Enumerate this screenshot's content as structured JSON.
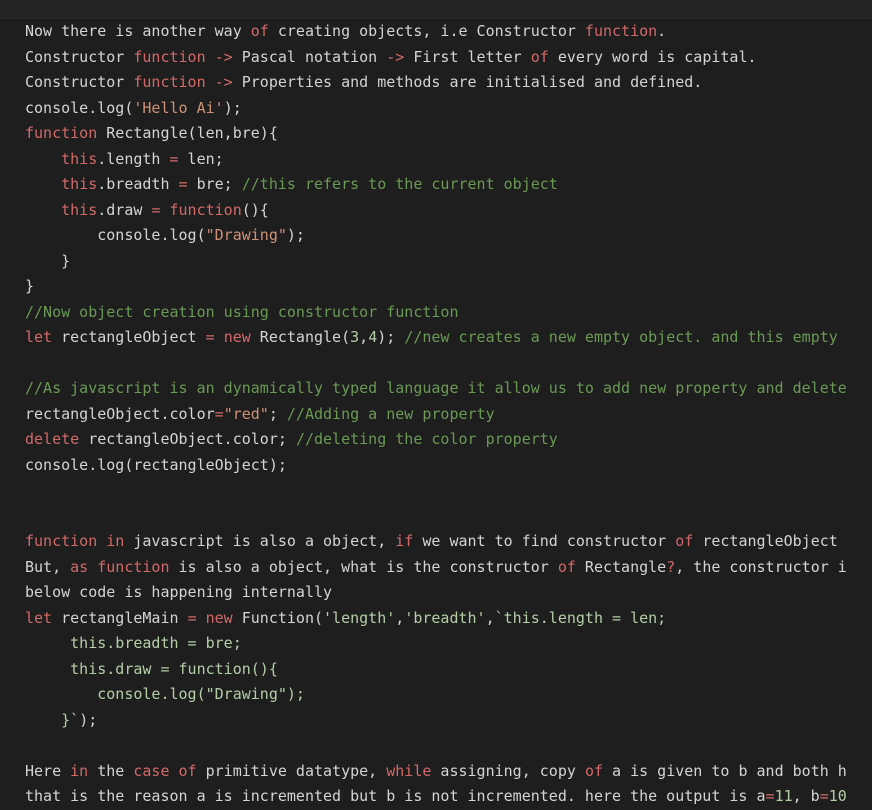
{
  "lines": [
    [
      {
        "c": "plain",
        "t": "Now there is another way "
      },
      {
        "c": "kw2",
        "t": "of"
      },
      {
        "c": "plain",
        "t": " creating objects, i.e Constructor "
      },
      {
        "c": "kw2",
        "t": "function"
      },
      {
        "c": "plain",
        "t": "."
      }
    ],
    [
      {
        "c": "plain",
        "t": "Constructor "
      },
      {
        "c": "kw2",
        "t": "function"
      },
      {
        "c": "plain",
        "t": " "
      },
      {
        "c": "kw2",
        "t": "->"
      },
      {
        "c": "plain",
        "t": " Pascal notation "
      },
      {
        "c": "kw2",
        "t": "->"
      },
      {
        "c": "plain",
        "t": " First letter "
      },
      {
        "c": "kw2",
        "t": "of"
      },
      {
        "c": "plain",
        "t": " every word is capital."
      }
    ],
    [
      {
        "c": "plain",
        "t": "Constructor "
      },
      {
        "c": "kw2",
        "t": "function"
      },
      {
        "c": "plain",
        "t": " "
      },
      {
        "c": "kw2",
        "t": "->"
      },
      {
        "c": "plain",
        "t": " Properties and methods are initialised and defined."
      }
    ],
    [
      {
        "c": "plain",
        "t": "console.log("
      },
      {
        "c": "str",
        "t": "'Hello Ai'"
      },
      {
        "c": "plain",
        "t": ");"
      }
    ],
    [
      {
        "c": "kw2",
        "t": "function"
      },
      {
        "c": "plain",
        "t": " Rectangle(len,bre){"
      }
    ],
    [
      {
        "c": "plain",
        "t": "    "
      },
      {
        "c": "kw2",
        "t": "this"
      },
      {
        "c": "plain",
        "t": ".length "
      },
      {
        "c": "kw2",
        "t": "="
      },
      {
        "c": "plain",
        "t": " len;"
      }
    ],
    [
      {
        "c": "plain",
        "t": "    "
      },
      {
        "c": "kw2",
        "t": "this"
      },
      {
        "c": "plain",
        "t": ".breadth "
      },
      {
        "c": "kw2",
        "t": "="
      },
      {
        "c": "plain",
        "t": " bre; "
      },
      {
        "c": "cmt",
        "t": "//this refers to the current object"
      }
    ],
    [
      {
        "c": "plain",
        "t": "    "
      },
      {
        "c": "kw2",
        "t": "this"
      },
      {
        "c": "plain",
        "t": ".draw "
      },
      {
        "c": "kw2",
        "t": "="
      },
      {
        "c": "plain",
        "t": " "
      },
      {
        "c": "kw2",
        "t": "function"
      },
      {
        "c": "plain",
        "t": "(){"
      }
    ],
    [
      {
        "c": "plain",
        "t": "        console.log("
      },
      {
        "c": "str",
        "t": "\"Drawing\""
      },
      {
        "c": "plain",
        "t": ");"
      }
    ],
    [
      {
        "c": "plain",
        "t": "    }"
      }
    ],
    [
      {
        "c": "plain",
        "t": "}"
      }
    ],
    [
      {
        "c": "cmt",
        "t": "//Now object creation using constructor function"
      }
    ],
    [
      {
        "c": "kw2",
        "t": "let"
      },
      {
        "c": "plain",
        "t": " rectangleObject "
      },
      {
        "c": "kw2",
        "t": "="
      },
      {
        "c": "plain",
        "t": " "
      },
      {
        "c": "kw2",
        "t": "new"
      },
      {
        "c": "plain",
        "t": " Rectangle("
      },
      {
        "c": "num",
        "t": "3"
      },
      {
        "c": "plain",
        "t": ","
      },
      {
        "c": "num",
        "t": "4"
      },
      {
        "c": "plain",
        "t": "); "
      },
      {
        "c": "cmt",
        "t": "//new creates a new empty object. and this empty"
      }
    ],
    [
      {
        "c": "plain",
        "t": ""
      }
    ],
    [
      {
        "c": "cmt",
        "t": "//As javascript is an dynamically typed language it allow us to add new property and delete"
      }
    ],
    [
      {
        "c": "plain",
        "t": "rectangleObject.color"
      },
      {
        "c": "kw2",
        "t": "="
      },
      {
        "c": "str",
        "t": "\"red\""
      },
      {
        "c": "plain",
        "t": "; "
      },
      {
        "c": "cmt",
        "t": "//Adding a new property"
      }
    ],
    [
      {
        "c": "kw2",
        "t": "delete"
      },
      {
        "c": "plain",
        "t": " rectangleObject.color; "
      },
      {
        "c": "cmt",
        "t": "//deleting the color property"
      }
    ],
    [
      {
        "c": "plain",
        "t": "console.log(rectangleObject);"
      }
    ],
    [
      {
        "c": "plain",
        "t": ""
      }
    ],
    [
      {
        "c": "plain",
        "t": ""
      }
    ],
    [
      {
        "c": "kw2",
        "t": "function"
      },
      {
        "c": "plain",
        "t": " "
      },
      {
        "c": "kw2",
        "t": "in"
      },
      {
        "c": "plain",
        "t": " javascript is also a object, "
      },
      {
        "c": "kw2",
        "t": "if"
      },
      {
        "c": "plain",
        "t": " we want to find constructor "
      },
      {
        "c": "kw2",
        "t": "of"
      },
      {
        "c": "plain",
        "t": " rectangleObject"
      }
    ],
    [
      {
        "c": "plain",
        "t": "But, "
      },
      {
        "c": "kw2",
        "t": "as"
      },
      {
        "c": "plain",
        "t": " "
      },
      {
        "c": "kw2",
        "t": "function"
      },
      {
        "c": "plain",
        "t": " is also a object, what is the constructor "
      },
      {
        "c": "kw2",
        "t": "of"
      },
      {
        "c": "plain",
        "t": " Rectangle"
      },
      {
        "c": "kw2",
        "t": "?"
      },
      {
        "c": "plain",
        "t": ", the constructor i"
      }
    ],
    [
      {
        "c": "plain",
        "t": "below code is happening internally"
      }
    ],
    [
      {
        "c": "kw2",
        "t": "let"
      },
      {
        "c": "plain",
        "t": " rectangleMain "
      },
      {
        "c": "kw2",
        "t": "="
      },
      {
        "c": "plain",
        "t": " "
      },
      {
        "c": "kw2",
        "t": "new"
      },
      {
        "c": "plain",
        "t": " Function("
      },
      {
        "c": "tpl",
        "t": "'length'"
      },
      {
        "c": "plain",
        "t": ","
      },
      {
        "c": "tpl",
        "t": "'breadth'"
      },
      {
        "c": "plain",
        "t": ","
      },
      {
        "c": "tpl",
        "t": "`this.length = len;"
      }
    ],
    [
      {
        "c": "tpl",
        "t": "     this.breadth = bre;"
      }
    ],
    [
      {
        "c": "tpl",
        "t": "     this.draw = function(){"
      }
    ],
    [
      {
        "c": "tpl",
        "t": "        console.log(\"Drawing\");"
      }
    ],
    [
      {
        "c": "tpl",
        "t": "    }`"
      },
      {
        "c": "plain",
        "t": ");"
      }
    ],
    [
      {
        "c": "plain",
        "t": ""
      }
    ],
    [
      {
        "c": "plain",
        "t": "Here "
      },
      {
        "c": "kw2",
        "t": "in"
      },
      {
        "c": "plain",
        "t": " the "
      },
      {
        "c": "kw2",
        "t": "case"
      },
      {
        "c": "plain",
        "t": " "
      },
      {
        "c": "kw2",
        "t": "of"
      },
      {
        "c": "plain",
        "t": " primitive datatype, "
      },
      {
        "c": "kw2",
        "t": "while"
      },
      {
        "c": "plain",
        "t": " assigning, copy "
      },
      {
        "c": "kw2",
        "t": "of"
      },
      {
        "c": "plain",
        "t": " a is given to b and both h"
      }
    ],
    [
      {
        "c": "plain",
        "t": "that is the reason a is incremented but b is not incremented. here the output is a"
      },
      {
        "c": "kw2",
        "t": "="
      },
      {
        "c": "num",
        "t": "11"
      },
      {
        "c": "plain",
        "t": ", b"
      },
      {
        "c": "kw2",
        "t": "="
      },
      {
        "c": "num",
        "t": "10"
      }
    ]
  ],
  "colors": {
    "background": "#1e1e1e",
    "keyword": "#d16969",
    "string": "#ce9178",
    "comment": "#6a9955",
    "number": "#b5cea8",
    "template": "#b5cea8"
  }
}
